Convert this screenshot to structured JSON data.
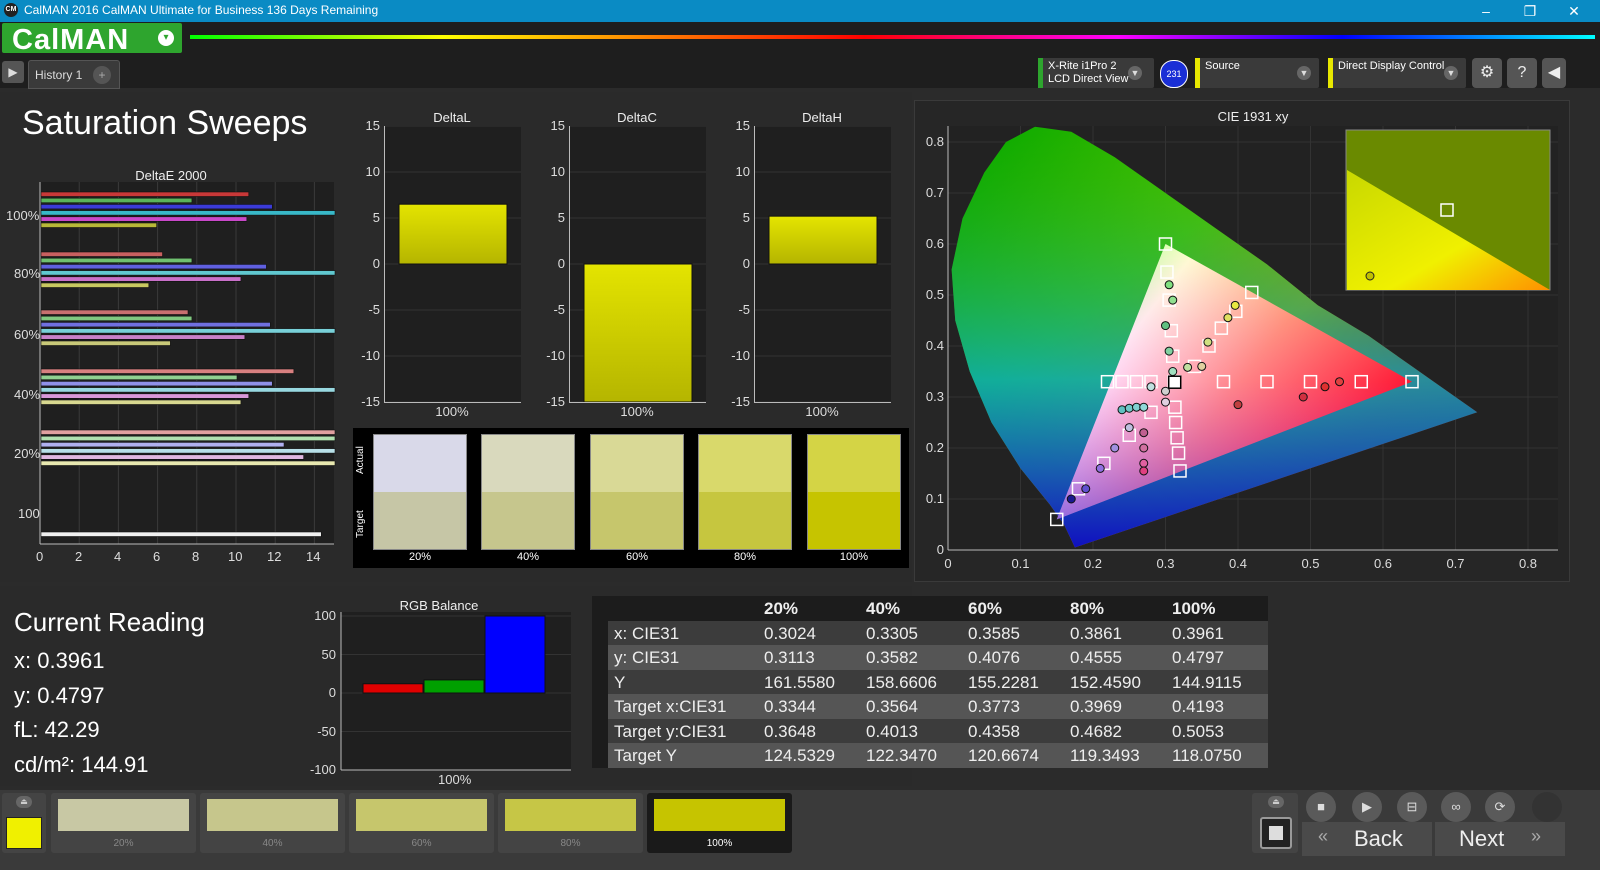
{
  "window": {
    "title": "CalMAN 2016 CalMAN Ultimate for Business 136 Days Remaining",
    "logo": "CM",
    "controls": [
      "–",
      "❐",
      "✕"
    ]
  },
  "header": {
    "brand": "CalMAN",
    "dropdown_icon": "▾"
  },
  "tabs": {
    "history": "History 1",
    "add": "+"
  },
  "devices": {
    "meter_line1": "X-Rite i1Pro 2",
    "meter_line2": "LCD Direct View",
    "meter_badge": "231",
    "source": "Source",
    "display": "Direct Display Control"
  },
  "colors": {
    "accent_green": "#2ea52e",
    "target_yellow": "#c9c400",
    "bar_yellow": "#c6c400",
    "red": "#e00000",
    "green": "#00a000",
    "blue": "#0000ff"
  },
  "page": {
    "title": "Saturation Sweeps"
  },
  "deltae": {
    "title": "DeltaE 2000",
    "ylabels": [
      "100%",
      "80%",
      "60%",
      "40%",
      "20%",
      "100"
    ],
    "xticks": [
      "0",
      "2",
      "4",
      "6",
      "8",
      "10",
      "12",
      "14"
    ]
  },
  "delta_charts": [
    {
      "title": "DeltaL",
      "value": 6.5,
      "label": "100%",
      "yticks": [
        "15",
        "10",
        "5",
        "0",
        "-5",
        "-10",
        "-15"
      ]
    },
    {
      "title": "DeltaC",
      "value": -15,
      "label": "100%",
      "yticks": [
        "15",
        "10",
        "5",
        "0",
        "-5",
        "-10",
        "-15"
      ]
    },
    {
      "title": "DeltaH",
      "value": 5.2,
      "label": "100%",
      "yticks": [
        "15",
        "10",
        "5",
        "0",
        "-5",
        "-10",
        "-15"
      ]
    }
  ],
  "swatches": {
    "actual_label": "Actual",
    "target_label": "Target",
    "items": [
      {
        "label": "20%",
        "actual": "#d9d9e9",
        "target": "#c6c6a6"
      },
      {
        "label": "40%",
        "actual": "#d9d9bd",
        "target": "#c6c68d"
      },
      {
        "label": "60%",
        "actual": "#d9d996",
        "target": "#c6c66c"
      },
      {
        "label": "80%",
        "actual": "#d9d96b",
        "target": "#c6c63f"
      },
      {
        "label": "100%",
        "actual": "#d4d445",
        "target": "#c6c400"
      }
    ]
  },
  "cie": {
    "title": "CIE 1931 xy",
    "xticks": [
      "0",
      "0.1",
      "0.2",
      "0.3",
      "0.4",
      "0.5",
      "0.6",
      "0.7",
      "0.8"
    ],
    "yticks": [
      "0",
      "0.1",
      "0.2",
      "0.3",
      "0.4",
      "0.5",
      "0.6",
      "0.7",
      "0.8"
    ]
  },
  "current_reading": {
    "title": "Current Reading",
    "x": "x: 0.3961",
    "y": "y: 0.4797",
    "fl": "fL: 42.29",
    "cdm2": "cd/m²: 144.91"
  },
  "rgb_balance": {
    "title": "RGB Balance",
    "yticks": [
      "100",
      "50",
      "0",
      "-50",
      "-100"
    ],
    "values": {
      "red": 12,
      "green": 17,
      "blue": 100
    },
    "label": "100%"
  },
  "table": {
    "headers": [
      "",
      "20%",
      "40%",
      "60%",
      "80%",
      "100%"
    ],
    "rows": [
      [
        "x: CIE31",
        "0.3024",
        "0.3305",
        "0.3585",
        "0.3861",
        "0.3961"
      ],
      [
        "y: CIE31",
        "0.3113",
        "0.3582",
        "0.4076",
        "0.4555",
        "0.4797"
      ],
      [
        "Y",
        "161.5580",
        "158.6606",
        "155.2281",
        "152.4590",
        "144.9115"
      ],
      [
        "Target x:CIE31",
        "0.3344",
        "0.3564",
        "0.3773",
        "0.3969",
        "0.4193"
      ],
      [
        "Target y:CIE31",
        "0.3648",
        "0.4013",
        "0.4358",
        "0.4682",
        "0.5053"
      ],
      [
        "Target Y",
        "124.5329",
        "122.3470",
        "120.6674",
        "119.3493",
        "118.0750"
      ]
    ]
  },
  "bottom": {
    "steps": [
      {
        "label": "20%",
        "color": "#c8c8a4"
      },
      {
        "label": "40%",
        "color": "#c6c68c"
      },
      {
        "label": "60%",
        "color": "#c6c66c"
      },
      {
        "label": "80%",
        "color": "#c6c646"
      },
      {
        "label": "100%",
        "color": "#c6c400"
      }
    ],
    "back": "Back",
    "next": "Next"
  }
}
